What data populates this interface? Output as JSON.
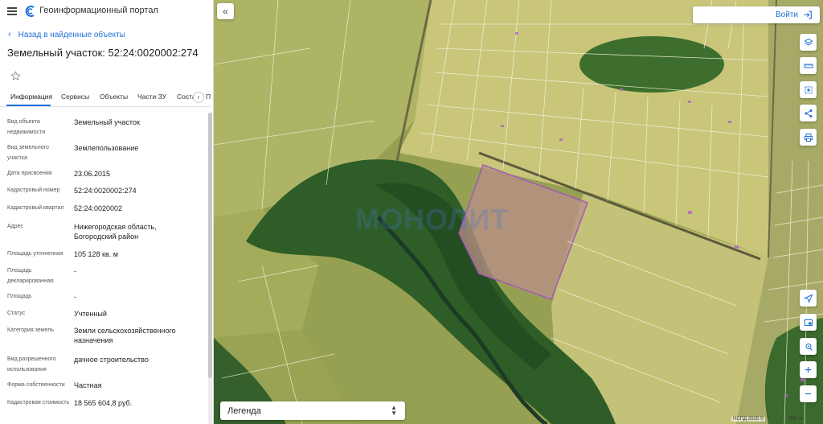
{
  "app": {
    "title": "Геоинформационный портал"
  },
  "nav": {
    "back_label": "Назад в найденные объекты"
  },
  "object": {
    "title": "Земельный участок: 52:24:0020002:274"
  },
  "tabs": [
    {
      "label": "Информация",
      "active": true
    },
    {
      "label": "Сервисы",
      "active": false
    },
    {
      "label": "Объекты",
      "active": false
    },
    {
      "label": "Части ЗУ",
      "active": false
    },
    {
      "label": "Соста",
      "active": false
    },
    {
      "label": "П",
      "active": false
    }
  ],
  "attributes": [
    {
      "label": "Вид объекта недвижимости",
      "value": "Земельный участок"
    },
    {
      "label": "Вид земельного участка",
      "value": "Землепользование"
    },
    {
      "label": "Дата присвоения",
      "value": "23.06.2015"
    },
    {
      "label": "Кадастровый номер",
      "value": "52:24:0020002:274"
    },
    {
      "label": "Кадастровый квартал",
      "value": "52:24:0020002"
    },
    {
      "label": "Адрес",
      "value": "Нижегородская область, Богородский район"
    },
    {
      "label": "Площадь уточненная",
      "value": "105 128 кв. м"
    },
    {
      "label": "Площадь декларированная",
      "value": "-"
    },
    {
      "label": "Площадь",
      "value": "-"
    },
    {
      "label": "Статус",
      "value": "Учтенный"
    },
    {
      "label": "Категория земель",
      "value": "Земли сельскохозяйственного назначения"
    },
    {
      "label": "Вид разрешенного использования",
      "value": "дачное строительство"
    },
    {
      "label": "Форма собственности",
      "value": "Частная"
    },
    {
      "label": "Кадастровая стоимость",
      "value": "18 565 604,8 руб."
    }
  ],
  "map": {
    "login_label": "Войти",
    "legend_label": "Легенда",
    "watermark": "МОНОЛИТ",
    "copyright": "НСПД 2025 ©",
    "scale": "300 m"
  },
  "colors": {
    "accent": "#1e6fd9",
    "parcel_outline": "#f2f2dc",
    "selected_parcel": "#a35bb5",
    "forest": "#2f5e2a",
    "fields": "#b9ba6a"
  }
}
